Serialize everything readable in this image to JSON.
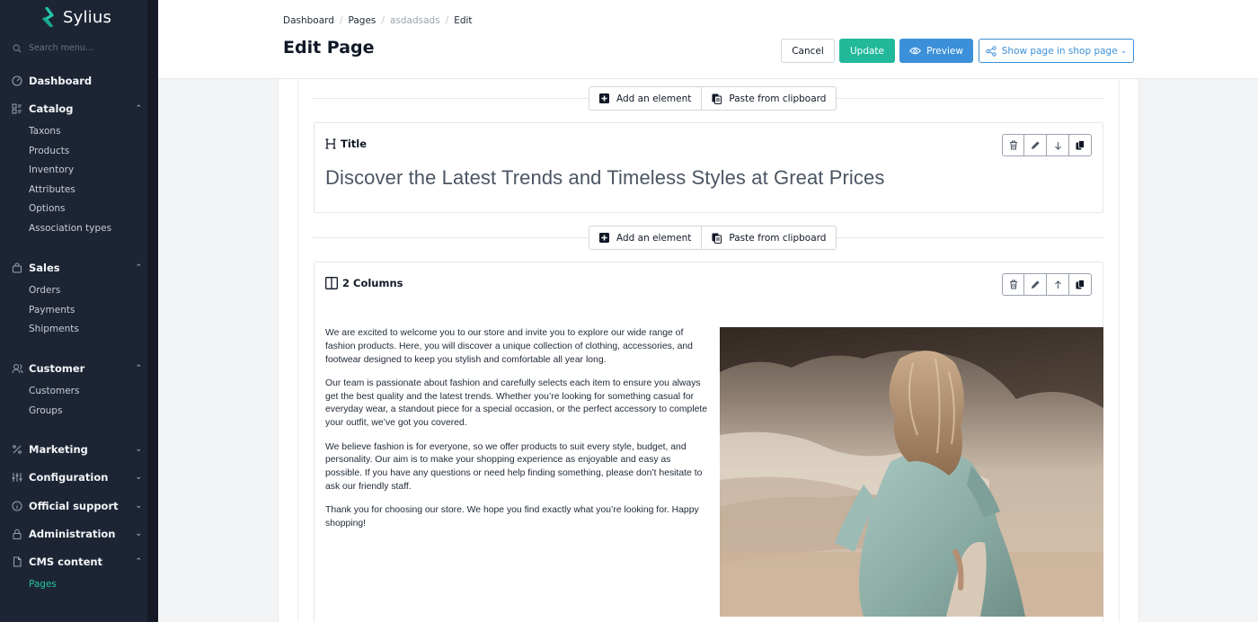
{
  "app": {
    "name": "Sylius"
  },
  "search": {
    "placeholder": "Search menu..."
  },
  "sidebar": {
    "dashboard": "Dashboard",
    "catalog": {
      "label": "Catalog",
      "items": [
        "Taxons",
        "Products",
        "Inventory",
        "Attributes",
        "Options",
        "Association types"
      ]
    },
    "sales": {
      "label": "Sales",
      "items": [
        "Orders",
        "Payments",
        "Shipments"
      ]
    },
    "customer": {
      "label": "Customer",
      "items": [
        "Customers",
        "Groups"
      ]
    },
    "marketing": "Marketing",
    "configuration": "Configuration",
    "official_support": "Official support",
    "administration": "Administration",
    "cms": {
      "label": "CMS content",
      "items": [
        "Pages"
      ]
    }
  },
  "breadcrumb": {
    "dashboard": "Dashboard",
    "pages": "Pages",
    "current": "asdadsads",
    "edit": "Edit"
  },
  "header": {
    "title": "Edit Page",
    "cancel": "Cancel",
    "update": "Update",
    "preview": "Preview",
    "show_in_shop": "Show page in shop page"
  },
  "editor": {
    "add_element": "Add an element",
    "paste": "Paste from clipboard",
    "title_block": {
      "label": "Title",
      "text": "Discover the Latest Trends and Timeless Styles at Great Prices"
    },
    "columns_block": {
      "label": "2 Columns",
      "paragraphs": [
        "We are excited to welcome you to our store and invite you to explore our wide range of fashion products. Here, you will discover a unique collection of clothing, accessories, and footwear designed to keep you stylish and comfortable all year long.",
        "Our team is passionate about fashion and carefully selects each item to ensure you always get the best quality and the latest trends. Whether you’re looking for something casual for everyday wear, a standout piece for a special occasion, or the perfect accessory to complete your outfit, we’ve got you covered.",
        "We believe fashion is for everyone, so we offer products to suit every style, budget, and personality. Our aim is to make your shopping experience as enjoyable and easy as possible. If you have any questions or need help finding something, please don’t hesitate to ask our friendly staff.",
        "Thank you for choosing our store. We hope you find exactly what you’re looking for. Happy shopping!"
      ]
    }
  },
  "colors": {
    "sidebar": "#1d2535",
    "accent": "#22b99b",
    "primary": "#3b90d9"
  }
}
